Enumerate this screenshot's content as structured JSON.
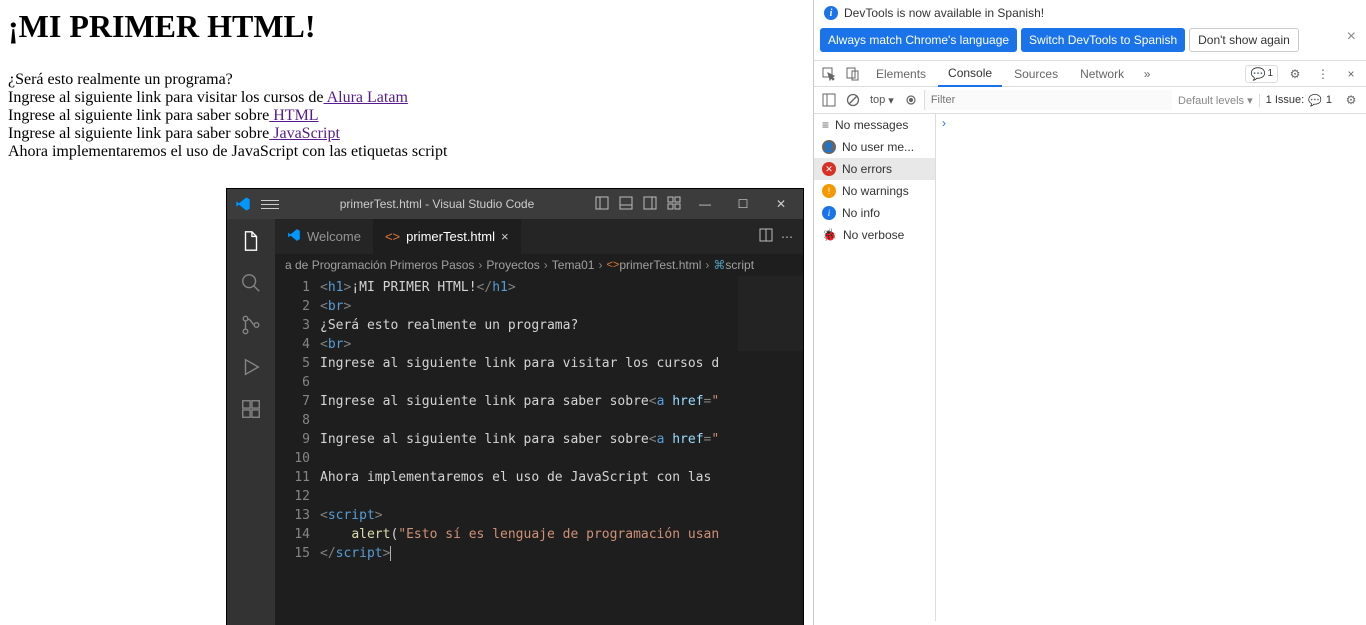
{
  "webpage": {
    "h1": "¡MI PRIMER HTML!",
    "line1": "¿Será esto realmente un programa?",
    "line2_pre": "Ingrese al siguiente link para visitar los cursos de",
    "link2": " Alura Latam",
    "line3_pre": "Ingrese al siguiente link para saber sobre",
    "link3": " HTML",
    "line4_pre": "Ingrese al siguiente link para saber sobre",
    "link4": " JavaScript",
    "line5": "Ahora implementaremos el uso de JavaScript con las etiquetas script"
  },
  "devtools": {
    "banner": "DevTools is now available in Spanish!",
    "btn_match": "Always match Chrome's language",
    "btn_switch": "Switch DevTools to Spanish",
    "btn_dont": "Don't show again",
    "tabs": {
      "elements": "Elements",
      "console": "Console",
      "sources": "Sources",
      "network": "Network"
    },
    "issue_badge": "1",
    "top": "top",
    "filter_ph": "Filter",
    "levels": "Default levels",
    "issue_label": "1 Issue:",
    "issue_count": "1",
    "sidebar": {
      "no_messages": "No messages",
      "no_user": "No user me...",
      "no_errors": "No errors",
      "no_warnings": "No warnings",
      "no_info": "No info",
      "no_verbose": "No verbose"
    },
    "prompt": "›"
  },
  "vscode": {
    "title": "primerTest.html - Visual Studio Code",
    "tabs": {
      "welcome": "Welcome",
      "file": "primerTest.html"
    },
    "breadcrumb": [
      "a de Programación Primeros Pasos",
      "Proyectos",
      "Tema01",
      "primerTest.html",
      "script"
    ],
    "code": {
      "l1": {
        "raw": "<h1>¡MI PRIMER HTML!</h1>"
      },
      "l2": {
        "raw": "<br>"
      },
      "l3": "¿Será esto realmente un programa?",
      "l4": {
        "raw": "<br>"
      },
      "l5": "Ingrese al siguiente link para visitar los cursos d",
      "l7_pre": "Ingrese al siguiente link para saber sobre",
      "l9_pre": "Ingrese al siguiente link para saber sobre",
      "l11": "Ahora implementaremos el uso de JavaScript con las ",
      "l14_str": "\"Esto sí es lenguaje de programación usan"
    }
  }
}
